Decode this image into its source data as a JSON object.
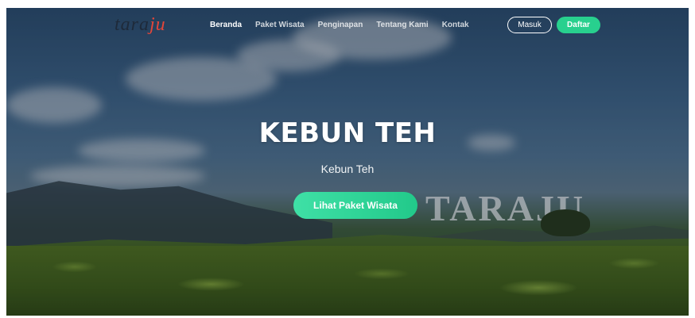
{
  "brand": {
    "logo_text_main": "tara",
    "logo_text_accent": "ju"
  },
  "nav": {
    "items": [
      {
        "label": "Beranda",
        "active": true
      },
      {
        "label": "Paket Wisata",
        "active": false
      },
      {
        "label": "Penginapan",
        "active": false
      },
      {
        "label": "Tentang Kami",
        "active": false
      },
      {
        "label": "Kontak",
        "active": false
      }
    ],
    "login_label": "Masuk",
    "register_label": "Daftar"
  },
  "hero": {
    "title": "KEBUN TEH",
    "subtitle": "Kebun Teh",
    "cta_label": "Lihat Paket Wisata",
    "sign_text": "TARAJU"
  },
  "colors": {
    "accent_green": "#28d08e",
    "logo_accent_red": "#e2463a"
  }
}
